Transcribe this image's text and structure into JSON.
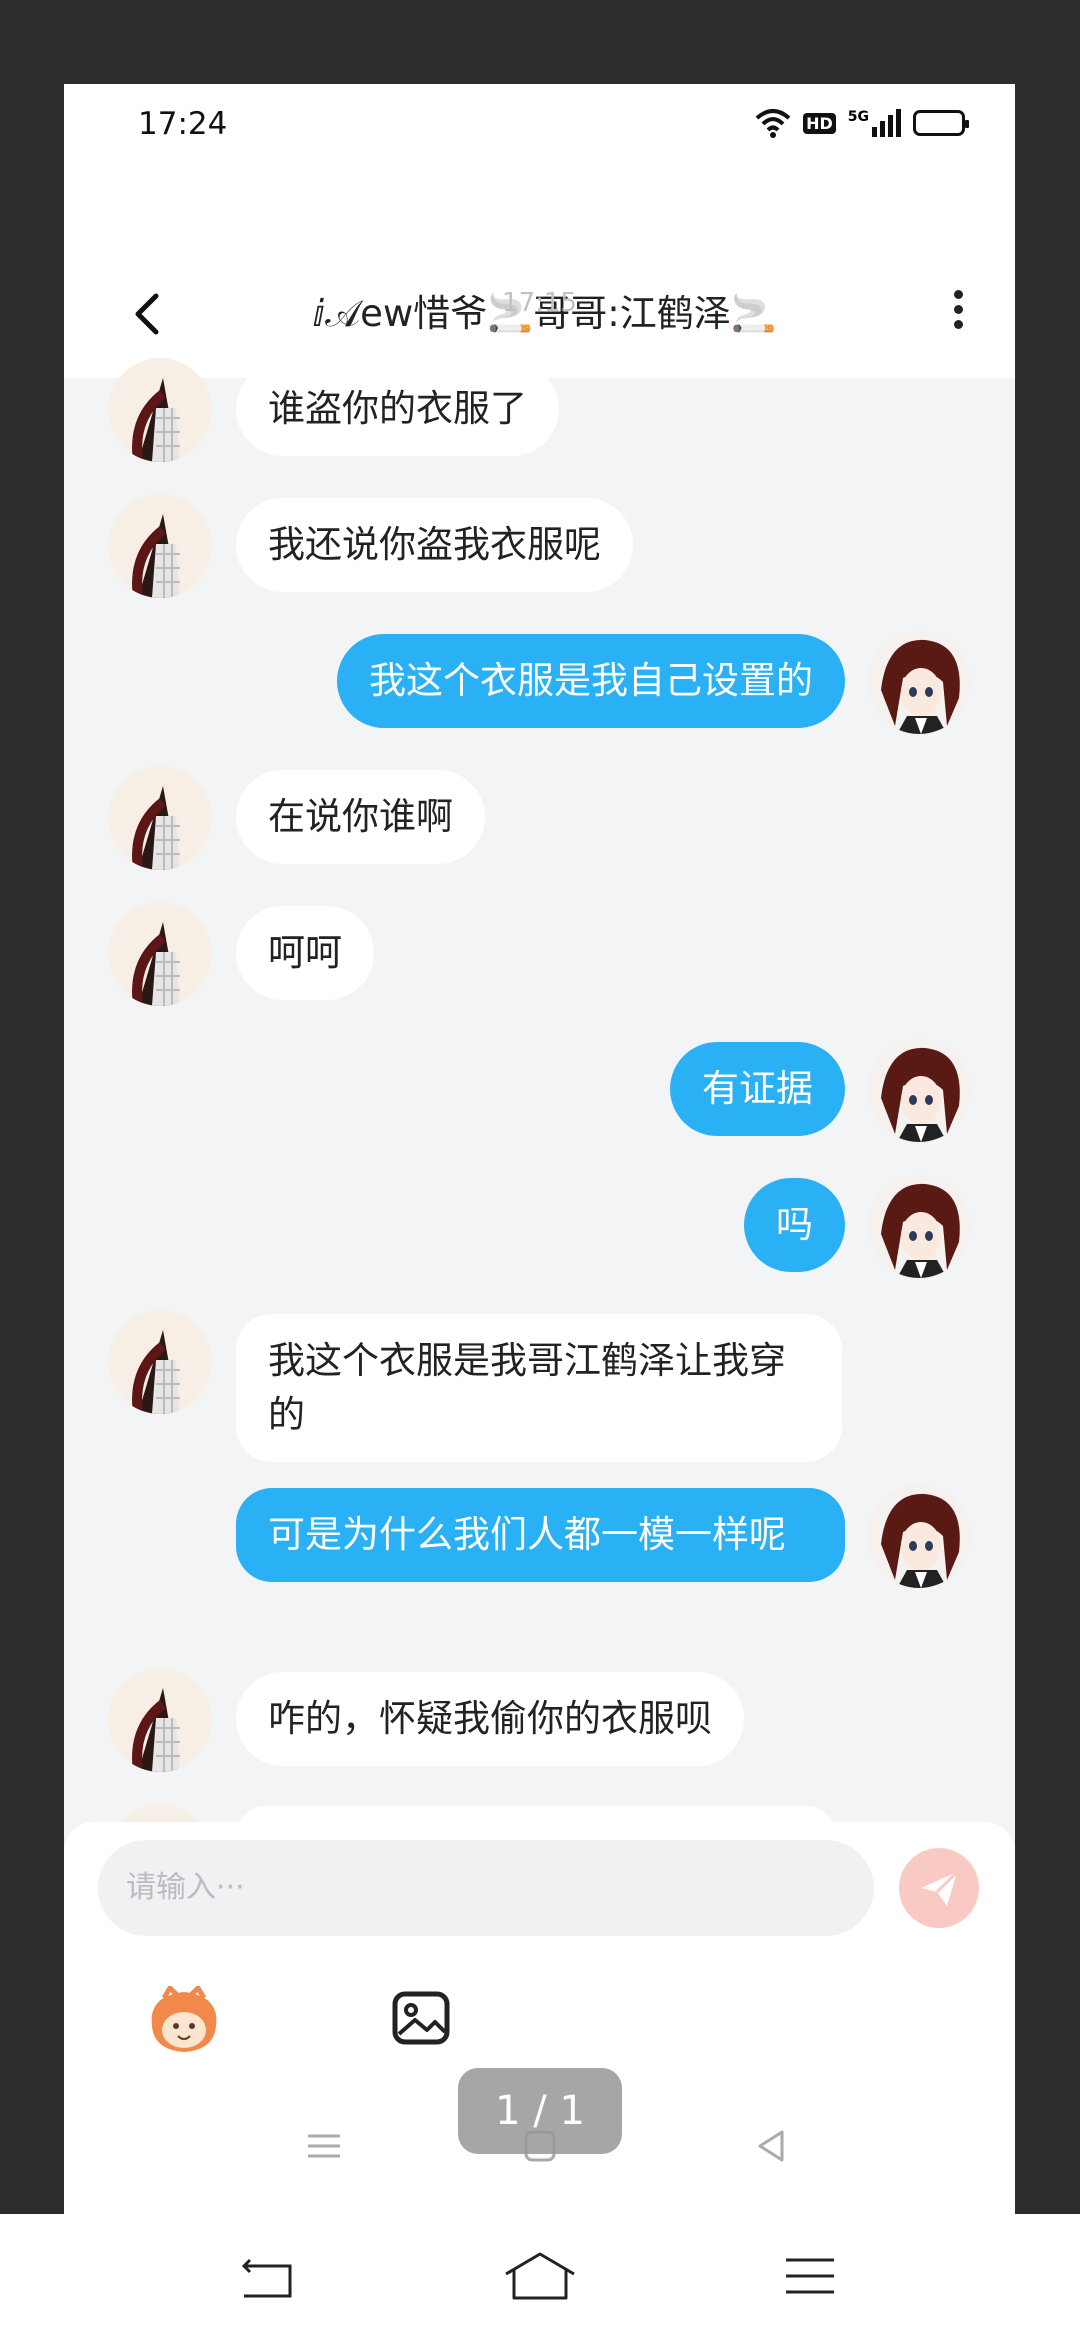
{
  "status": {
    "time": "17:24",
    "hd": "HD",
    "net": "5G"
  },
  "header": {
    "title": "ⅈ𝒜ew惜爷🚬哥哥:江鹤泽🚬"
  },
  "timestamp": "17:15",
  "messages": [
    {
      "side": "in",
      "text": "谁盗你的衣服了"
    },
    {
      "side": "in",
      "text": "我还说你盗我衣服呢"
    },
    {
      "side": "out",
      "text": "我这个衣服是我自己设置的"
    },
    {
      "side": "in",
      "text": "在说你谁啊"
    },
    {
      "side": "in",
      "text": "呵呵"
    },
    {
      "side": "out",
      "text": "有证据"
    },
    {
      "side": "out",
      "text": "吗"
    },
    {
      "side": "in",
      "text": "我这个衣服是我哥江鹤泽让我穿的"
    },
    {
      "side": "out",
      "text": "可是为什么我们人都一模一样呢"
    },
    {
      "side": "in",
      "text": "咋的，怀疑我偷你的衣服呗"
    }
  ],
  "input": {
    "placeholder": "请输入···"
  },
  "page_indicator": "1 / 1",
  "colors": {
    "bubble_out": "#29b0f5",
    "bubble_in": "#ffffff",
    "send": "#f9c9c4"
  },
  "icons": [
    "back-icon",
    "more-icon",
    "wifi-icon",
    "signal-icon",
    "battery-icon",
    "send-icon",
    "sticker-icon",
    "image-icon"
  ]
}
